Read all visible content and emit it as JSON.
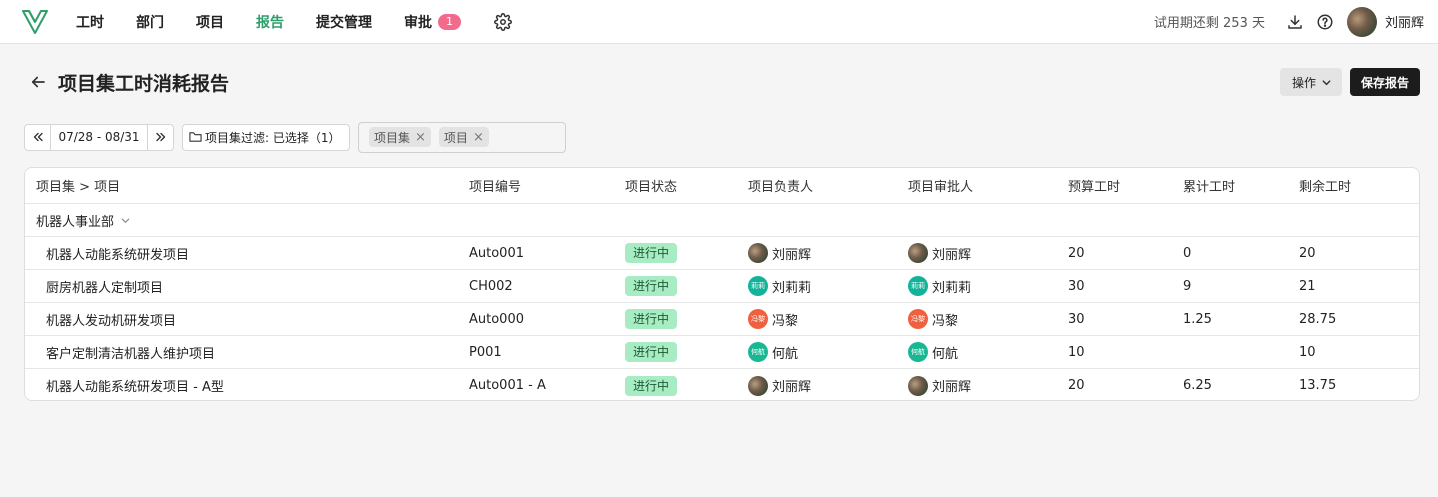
{
  "nav": {
    "items": [
      {
        "label": "工时",
        "active": false
      },
      {
        "label": "部门",
        "active": false
      },
      {
        "label": "项目",
        "active": false
      },
      {
        "label": "报告",
        "active": true
      },
      {
        "label": "提交管理",
        "active": false
      },
      {
        "label": "审批",
        "active": false,
        "badge": "1"
      }
    ],
    "settings_icon": "gear-icon"
  },
  "topright": {
    "trial_text": "试用期还剩 253 天",
    "username": "刘丽辉",
    "download_icon": "download-icon",
    "help_icon": "help-icon"
  },
  "page": {
    "title": "项目集工时消耗报告",
    "ops_label": "操作",
    "save_label": "保存报告"
  },
  "filters": {
    "date_range": "07/28 - 08/31",
    "set_filter_label": "项目集过滤: 已选择（1）",
    "chips": [
      "项目集",
      "项目"
    ]
  },
  "table": {
    "headers": [
      "项目集 > 项目",
      "项目编号",
      "项目状态",
      "项目负责人",
      "项目审批人",
      "预算工时",
      "累计工时",
      "剩余工时"
    ],
    "group": "机器人事业部",
    "rows": [
      {
        "name": "机器人动能系统研发项目",
        "code": "Auto001",
        "status": "进行中",
        "owner": "刘丽辉",
        "owner_av": "photo",
        "owner_av_text": "",
        "approver": "刘丽辉",
        "approver_av": "photo",
        "approver_av_text": "",
        "budget": "20",
        "spent": "0",
        "remain": "20"
      },
      {
        "name": "厨房机器人定制项目",
        "code": "CH002",
        "status": "进行中",
        "owner": "刘莉莉",
        "owner_av": "teal",
        "owner_av_text": "莉莉",
        "approver": "刘莉莉",
        "approver_av": "teal",
        "approver_av_text": "莉莉",
        "budget": "30",
        "spent": "9",
        "remain": "21"
      },
      {
        "name": "机器人发动机研发项目",
        "code": "Auto000",
        "status": "进行中",
        "owner": "冯黎",
        "owner_av": "orange",
        "owner_av_text": "冯黎",
        "approver": "冯黎",
        "approver_av": "orange",
        "approver_av_text": "冯黎",
        "budget": "30",
        "spent": "1.25",
        "remain": "28.75"
      },
      {
        "name": "客户定制清洁机器人维护项目",
        "code": "P001",
        "status": "进行中",
        "owner": "何航",
        "owner_av": "teal2",
        "owner_av_text": "何航",
        "approver": "何航",
        "approver_av": "teal2",
        "approver_av_text": "何航",
        "budget": "10",
        "spent": "",
        "remain": "10"
      },
      {
        "name": "机器人动能系统研发项目 - A型",
        "code": "Auto001 - A",
        "status": "进行中",
        "owner": "刘丽辉",
        "owner_av": "photo",
        "owner_av_text": "",
        "approver": "刘丽辉",
        "approver_av": "photo",
        "approver_av_text": "",
        "budget": "20",
        "spent": "6.25",
        "remain": "13.75"
      }
    ]
  },
  "colors": {
    "accent": "#2e9e6b",
    "badge": "#f26b8a",
    "status_bg": "#a8ecc3"
  }
}
